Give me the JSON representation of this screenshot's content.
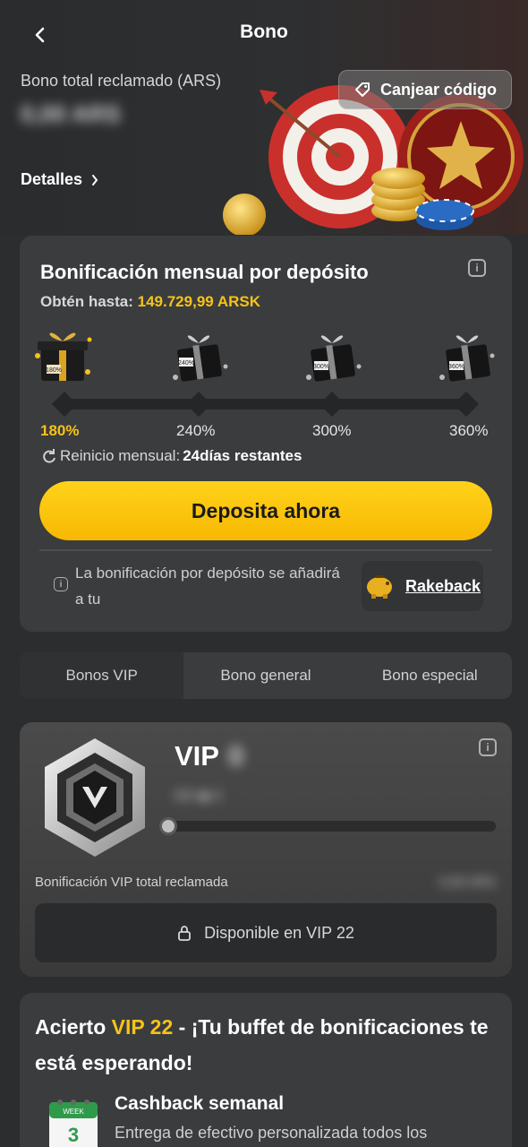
{
  "header": {
    "title": "Bono",
    "total_label": "Bono total reclamado (ARS)",
    "total_amount": "0,00 ARS",
    "details_label": "Detalles",
    "redeem_label": "Canjear código"
  },
  "deposit": {
    "title": "Bonificación mensual por depósito",
    "subtitle_prefix": "Obtén hasta:",
    "subtitle_amount": "149.729,99 ARSK",
    "tiers": [
      "180%",
      "240%",
      "300%",
      "360%"
    ],
    "gift_labels": [
      "180%",
      "240%",
      "300%",
      "360%"
    ],
    "reset_label": "Reinicio mensual:",
    "reset_value": "24días restantes",
    "button_label": "Deposita ahora",
    "note_text": "La bonificación por depósito se añadirá a tu",
    "rakeback_label": "Rakeback"
  },
  "tabs": [
    "Bonos VIP",
    "Bono general",
    "Bono especial"
  ],
  "vip": {
    "title": "VIP",
    "level": "0",
    "progress_text": "0/0 ◆ 0",
    "progress": 0,
    "claimed_label": "Bonificación VIP total reclamada",
    "claimed_value": "0,00 ARS",
    "locked_label": "Disponible en VIP 22"
  },
  "promo": {
    "title_prefix": "Acierto",
    "title_highlight": "VIP 22",
    "title_suffix": "- ¡Tu buffet de bonificaciones te está esperando!",
    "cashback_title": "Cashback semanal",
    "cashback_desc": "Entrega de efectivo personalizada todos los",
    "calendar_week": "WEEK",
    "calendar_day": "3"
  },
  "colors": {
    "accent": "#f6c318",
    "background": "#2b2d2f",
    "card": "#3a3c3e"
  }
}
